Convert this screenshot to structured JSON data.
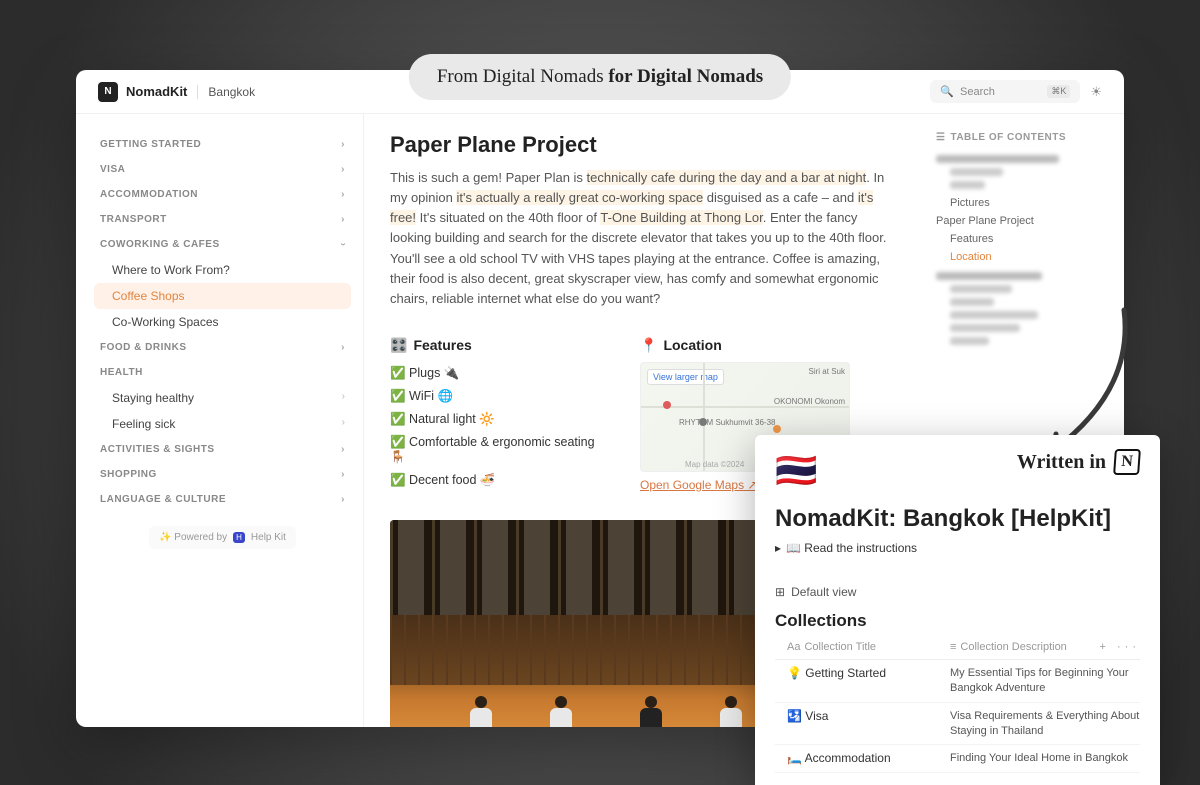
{
  "tagline": {
    "pre": "From Digital Nomads ",
    "bold": "for Digital Nomads"
  },
  "header": {
    "brand": "NomadKit",
    "crumb": "Bangkok",
    "search_placeholder": "Search",
    "kbd": "⌘K"
  },
  "sidebar": {
    "cats": [
      {
        "label": "GETTING STARTED",
        "open": false
      },
      {
        "label": "VISA",
        "open": false
      },
      {
        "label": "ACCOMMODATION",
        "open": false
      },
      {
        "label": "TRANSPORT",
        "open": false
      },
      {
        "label": "COWORKING & CAFES",
        "open": true,
        "subs": [
          {
            "label": "Where to Work From?"
          },
          {
            "label": "Coffee Shops",
            "active": true
          },
          {
            "label": "Co-Working Spaces"
          }
        ]
      },
      {
        "label": "FOOD & DRINKS",
        "open": false
      },
      {
        "label": "HEALTH",
        "nochev": true,
        "subs": [
          {
            "label": "Staying healthy",
            "chev": true
          },
          {
            "label": "Feeling sick",
            "chev": true
          }
        ]
      },
      {
        "label": "ACTIVITIES & SIGHTS",
        "open": false
      },
      {
        "label": "SHOPPING",
        "open": false
      },
      {
        "label": "LANGUAGE & CULTURE",
        "open": false
      }
    ],
    "powered_pre": "✨ Powered by",
    "powered_name": "Help Kit"
  },
  "article": {
    "title": "Paper Plane Project",
    "p1a": "This is such a gem! Paper Plan is ",
    "p1h1": "technically cafe during the day and a bar at night",
    "p1b": ". In my opinion ",
    "p1h2": "it's actually a really great co-working space",
    "p1c": " disguised as a cafe – and ",
    "p1h3": "it's free!",
    "p1d": " It's situated on the 40th floor of ",
    "p1h4": "T-One Building at Thong Lor",
    "p1e": ". Enter the fancy looking building and search for the discrete elevator that takes you up to the 40th floor. You'll see a old school TV with VHS tapes playing at the entrance. Coffee is amazing, their food is also decent, great skyscraper view, has comfy and somewhat ergonomic chairs, reliable internet what else do you want?",
    "features_h": "Features",
    "features": [
      "Plugs 🔌",
      "WiFi 🌐",
      "Natural light 🔆",
      "Comfortable & ergonomic seating 🪑",
      "Decent food 🍜"
    ],
    "location_h": "Location",
    "map_btn": "View larger map",
    "map_label1": "RHYTHM Sukhumvit 36-38",
    "map_label2": "Siri at Suk",
    "map_label3": "OKONOMI Okonom",
    "map_attr": "Map data ©2024",
    "open_maps": "Open Google Maps ↗"
  },
  "toc": {
    "heading": "TABLE OF CONTENTS",
    "items": [
      {
        "label": "Pictures",
        "lvl": 2
      },
      {
        "label": "Paper Plane Project",
        "lvl": 1
      },
      {
        "label": "Features",
        "lvl": 2
      },
      {
        "label": "Location",
        "lvl": 2,
        "active": true
      }
    ]
  },
  "notion": {
    "written_in": "Written in",
    "flag": "🇹🇭",
    "title": "NomadKit: Bangkok [HelpKit]",
    "toggle": "📖 Read the instructions",
    "view": "Default view",
    "collections_h": "Collections",
    "col_title_h": "Collection Title",
    "col_desc_h": "Collection Description",
    "rows": [
      {
        "emoji": "💡",
        "title": "Getting Started",
        "desc": "My Essential Tips for Beginning Your Bangkok Adventure"
      },
      {
        "emoji": "🛂",
        "title": "Visa",
        "desc": "Visa Requirements & Everything About Staying in Thailand"
      },
      {
        "emoji": "🛏️",
        "title": "Accommodation",
        "desc": "Finding Your Ideal Home in Bangkok"
      }
    ]
  }
}
